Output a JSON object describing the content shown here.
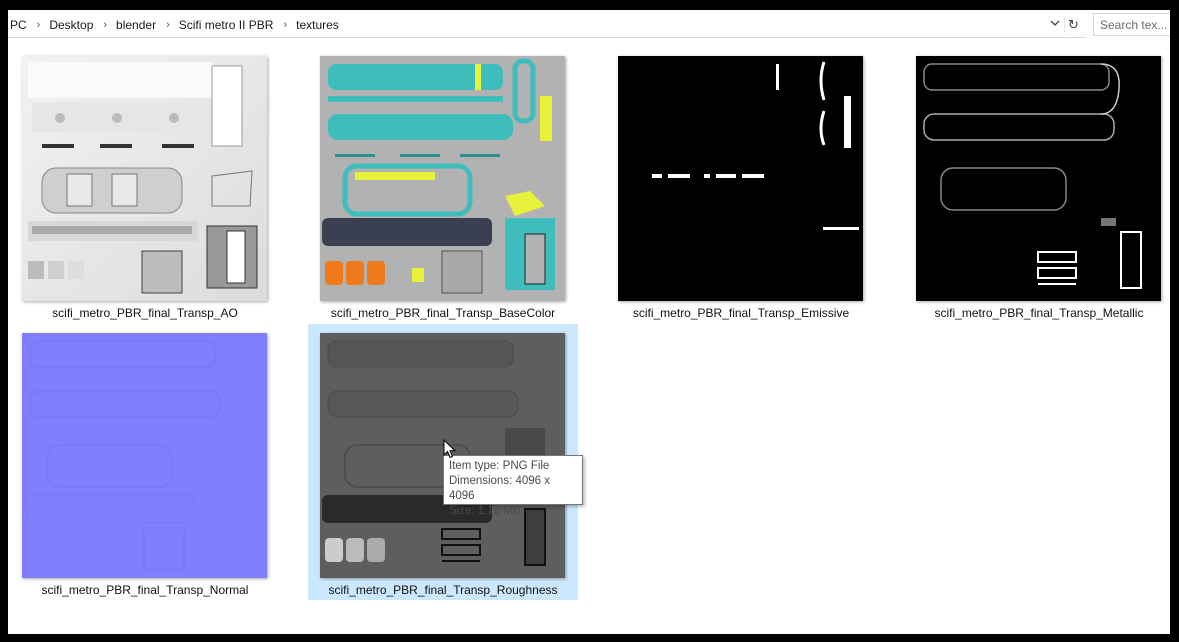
{
  "breadcrumb": [
    "PC",
    "Desktop",
    "blender",
    "Scifi metro II PBR",
    "textures"
  ],
  "search": {
    "placeholder": "Search tex..."
  },
  "files": [
    {
      "name": "scifi_metro_PBR_final_Transp_AO",
      "map": "ao"
    },
    {
      "name": "scifi_metro_PBR_final_Transp_BaseColor",
      "map": "basecolor"
    },
    {
      "name": "scifi_metro_PBR_final_Transp_Emissive",
      "map": "emissive"
    },
    {
      "name": "scifi_metro_PBR_final_Transp_Metallic",
      "map": "metallic"
    },
    {
      "name": "scifi_metro_PBR_final_Transp_Normal",
      "map": "normal"
    },
    {
      "name": "scifi_metro_PBR_final_Transp_Roughness",
      "map": "roughness"
    }
  ],
  "tooltip": {
    "item_type": "Item type: PNG File",
    "dimensions": "Dimensions: 4096 x 4096",
    "size": "Size: 1,16 MB"
  },
  "icons": {
    "chevron": "chevron-right-icon",
    "dropdown": "chevron-down-icon",
    "refresh": "refresh-icon",
    "cursor": "mouse-pointer-icon"
  },
  "colors": {
    "selection": "#cce8ff",
    "normal_map": "#7f7ffe",
    "basecolor_bg": "#b2b2b2",
    "teal": "#3fbcbc",
    "yellow": "#e8f23a",
    "orange": "#ee7a1c",
    "navy": "#3a4052"
  }
}
